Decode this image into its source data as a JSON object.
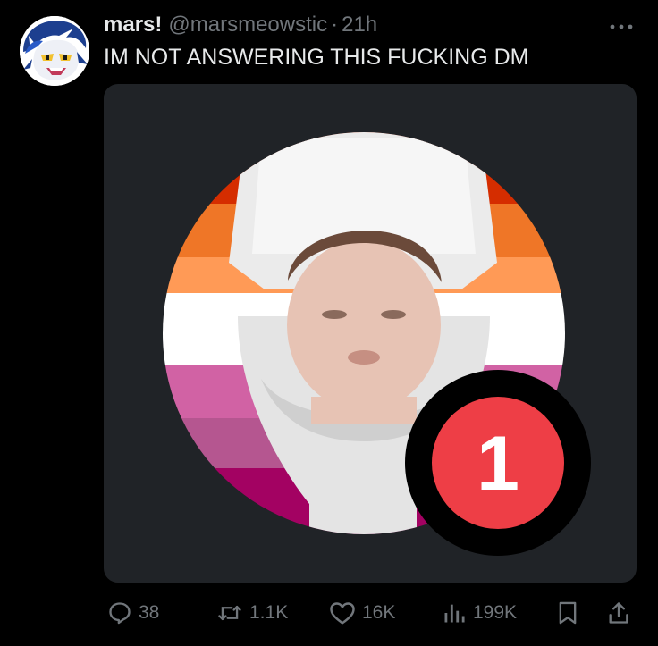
{
  "tweet": {
    "author": {
      "display_name": "mars!",
      "handle": "@marsmeowstic",
      "avatar_icon": "cartoon-character-avatar"
    },
    "separator": "·",
    "timestamp": "21h",
    "text": "IM NOT ANSWERING THIS FUCKING DM",
    "media": {
      "description_icon": "profile-picture-with-notification-badge",
      "badge_count": "1",
      "flag_colors": [
        "#d52d00",
        "#ef7627",
        "#ff9a56",
        "#ffffff",
        "#d162a4",
        "#b55690",
        "#a30262"
      ],
      "badge_color": "#ee3e46"
    },
    "actions": {
      "replies": "38",
      "reposts": "1.1K",
      "likes": "16K",
      "views": "199K"
    }
  },
  "colors": {
    "background": "#000000",
    "text": "#e7e9ea",
    "muted": "#71767b",
    "media_bg": "#202327"
  }
}
